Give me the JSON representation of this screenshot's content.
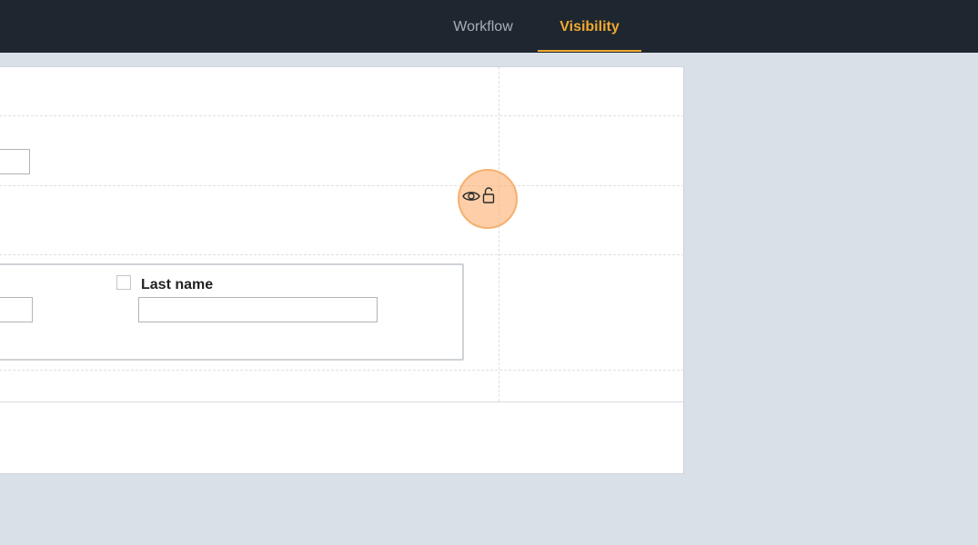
{
  "header": {
    "tabs": [
      {
        "label": "Workflow",
        "active": false
      },
      {
        "label": "Visibility",
        "active": true
      }
    ],
    "accent_color": "#f0a830",
    "background_color": "#1e2730"
  },
  "form": {
    "last_name_field": {
      "label": "Last name",
      "value": "",
      "checked": false
    },
    "visibility_controls": {
      "icons": [
        "eye-icon",
        "unlock-icon"
      ]
    }
  }
}
